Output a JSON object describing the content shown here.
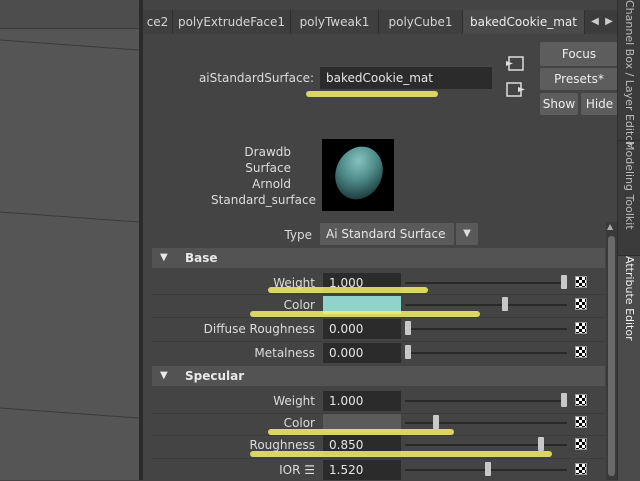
{
  "tabs": [
    {
      "label": "ce2"
    },
    {
      "label": "polyExtrudeFace1"
    },
    {
      "label": "polyTweak1"
    },
    {
      "label": "polyCube1"
    },
    {
      "label": "bakedCookie_mat"
    }
  ],
  "tab_arrow_left": "◀",
  "tab_arrow_right": "▶",
  "side_tabs": [
    {
      "label": "Channel Box / Layer Editor"
    },
    {
      "label": "Modeling Toolkit"
    },
    {
      "label": "Attribute Editor"
    }
  ],
  "node": {
    "type_label": "aiStandardSurface:",
    "name_value": "bakedCookie_mat",
    "focus_label": "Focus",
    "presets_label": "Presets*",
    "show_label": "Show",
    "hide_label": "Hide"
  },
  "swatch": {
    "info_lines": [
      "Drawdb",
      "Surface",
      "Arnold",
      "Standard_surface"
    ],
    "type_label": "Type",
    "type_value": "Ai Standard Surface"
  },
  "sections": {
    "base": {
      "title": "Base",
      "weight_label": "Weight",
      "weight_value": "1.000",
      "weight_level": 1.0,
      "color_label": "Color",
      "color_hex": "#8fd3cc",
      "color_level": 0.62,
      "diffuse_roughness_label": "Diffuse Roughness",
      "diffuse_roughness_value": "0.000",
      "diffuse_roughness_level": 0.0,
      "metalness_label": "Metalness",
      "metalness_value": "0.000",
      "metalness_level": 0.0
    },
    "specular": {
      "title": "Specular",
      "weight_label": "Weight",
      "weight_value": "1.000",
      "weight_level": 1.0,
      "color_label": "Color",
      "color_hex": "#5b5b5b",
      "color_level": 0.18,
      "roughness_label": "Roughness",
      "roughness_value": "0.850",
      "roughness_level": 0.85,
      "ior_label": "IOR ☰",
      "ior_value": "1.520",
      "ior_level": 0.51
    }
  },
  "colors": {
    "highlight": "#f4f06a",
    "sphere": "#4e8a88"
  }
}
